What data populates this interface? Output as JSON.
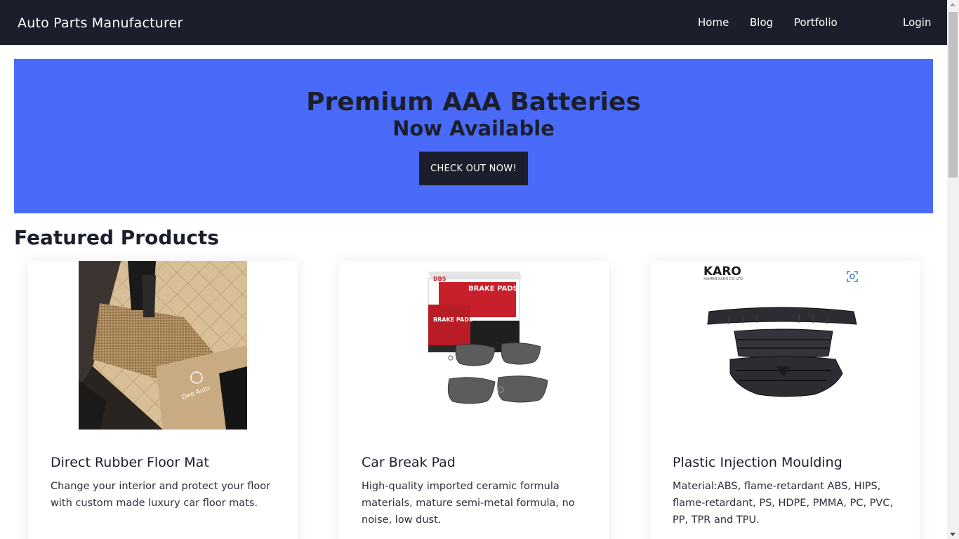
{
  "navbar": {
    "brand": "Auto Parts Manufacturer",
    "links": [
      {
        "label": "Home"
      },
      {
        "label": "Blog"
      },
      {
        "label": "Portfolio"
      },
      {
        "label": "Login"
      }
    ]
  },
  "hero": {
    "title": "Premium AAA Batteries",
    "subtitle": "Now Available",
    "button_label": "CHECK OUT NOW!",
    "background_color": "#4a6bfa"
  },
  "featured": {
    "title": "Featured Products",
    "products": [
      {
        "name": "Direct Rubber Floor Mat",
        "description": "Change your interior and protect your floor with custom made luxury car floor mats.",
        "image_icon": "floor-mat-image",
        "image_text": "Dee Auto"
      },
      {
        "name": "Car Break Pad",
        "description": "High-quality imported ceramic formula materials, mature semi-metal formula, no noise, low dust.",
        "image_icon": "brake-pads-image",
        "image_box_brand": "DBS",
        "image_box_label": "BRAKE PADS",
        "image_box_label_short": "BRAKE PADS"
      },
      {
        "name": "Plastic Injection Moulding",
        "description": "Material:ABS, flame-retardant ABS, HIPS, flame-retardant, PS, HDPE, PMMA, PC, PVC, PP, TPR and TPU.",
        "image_icon": "car-grille-image",
        "image_logo": "KARO",
        "image_logo_sub": "XIAMEN KARO CO.,LTD"
      }
    ]
  },
  "colors": {
    "nav_bg": "#1c1f2b",
    "accent": "#4a6bfa"
  }
}
